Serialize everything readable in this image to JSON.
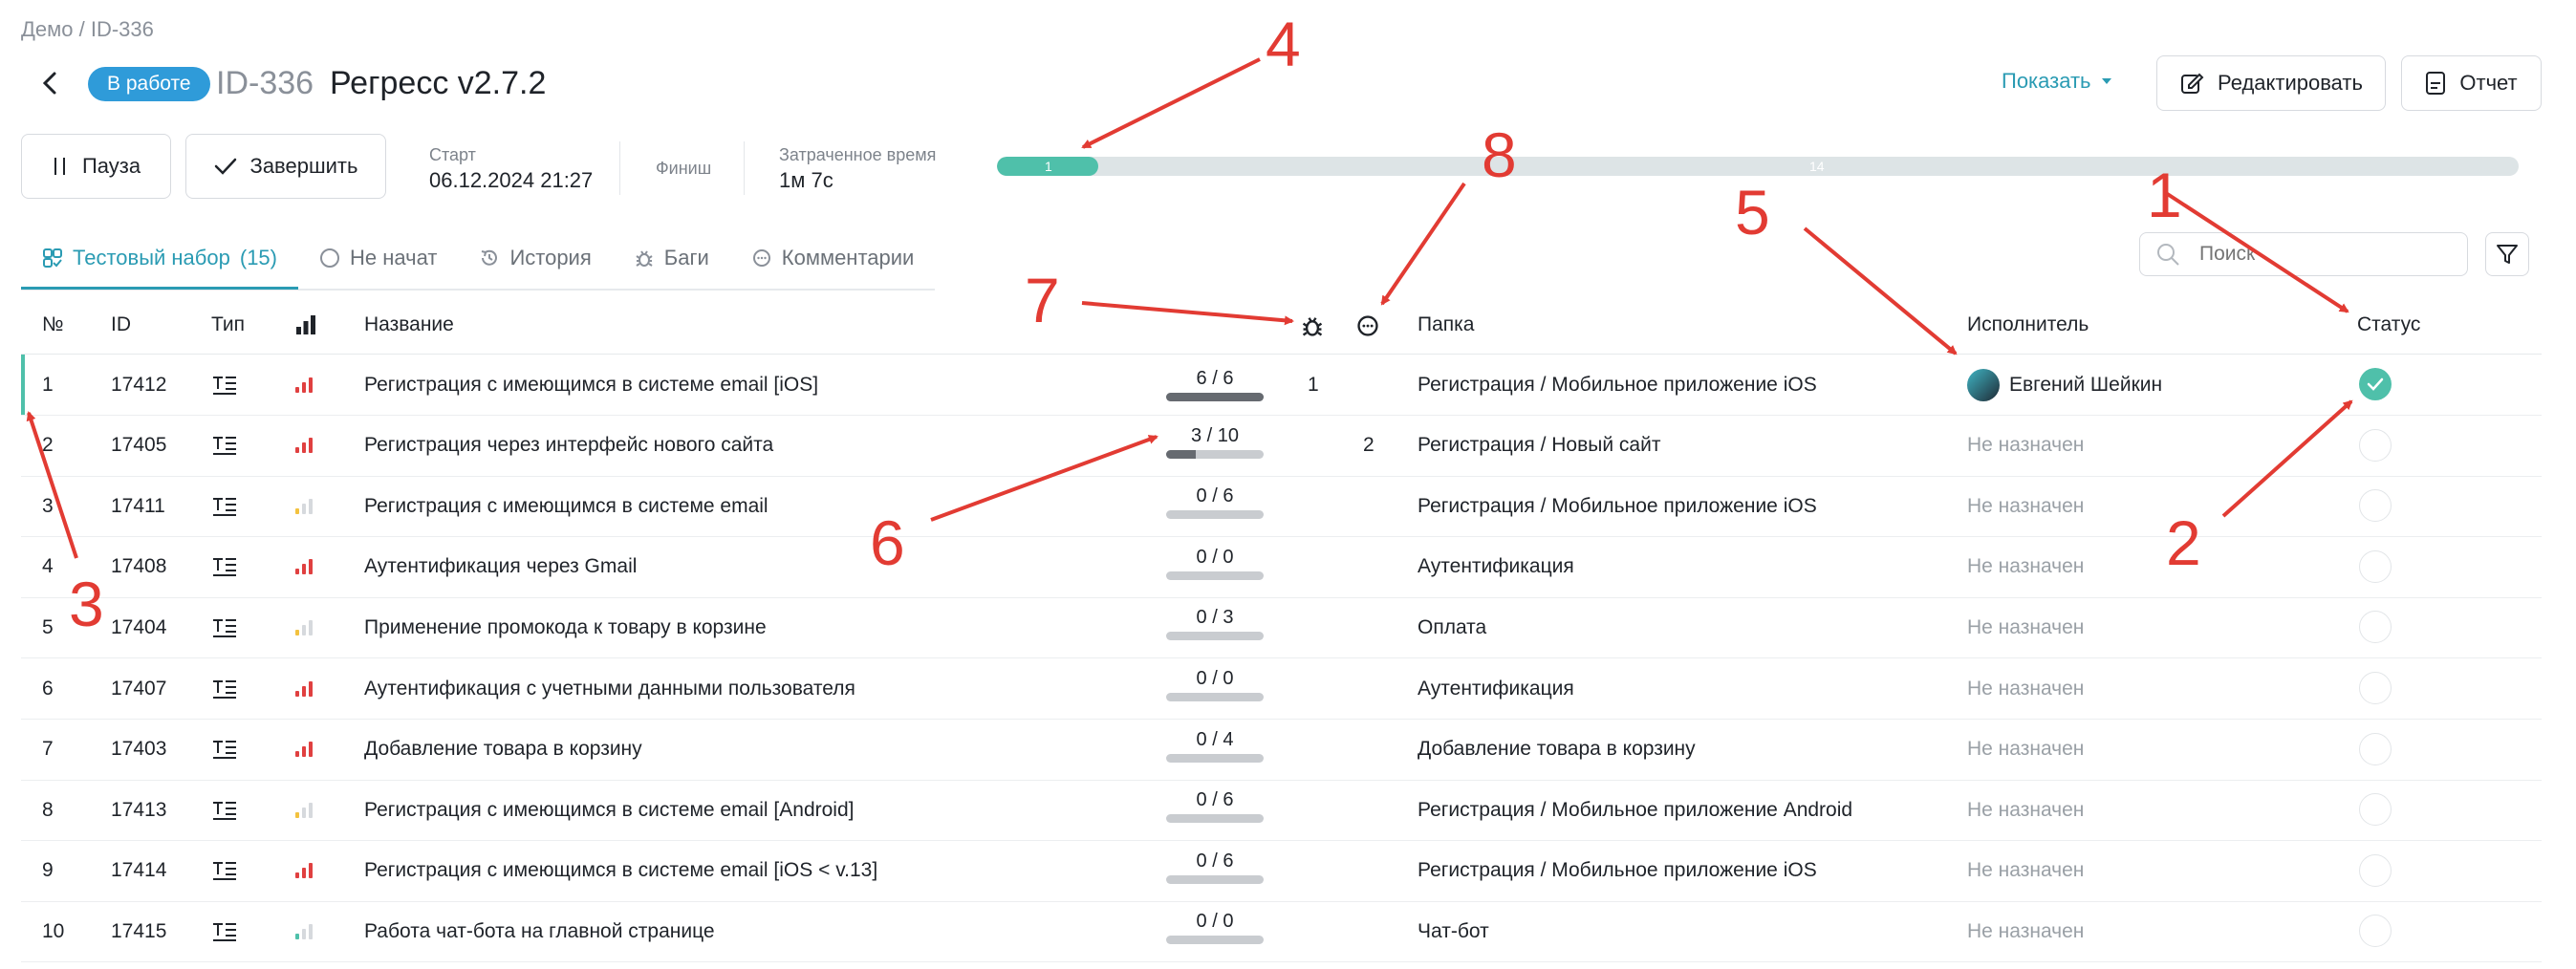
{
  "breadcrumb": "Демо / ID-336",
  "run": {
    "status": "В работе",
    "id": "ID-336",
    "name": "Регресс v2.7.2"
  },
  "toolbar": {
    "show_label": "Показать",
    "edit_label": "Редактировать",
    "report_label": "Отчет",
    "pause_label": "Пауза",
    "finish_label": "Завершить"
  },
  "meta": {
    "start_label": "Старт",
    "start_value": "06.12.2024 21:27",
    "finish_label": "Финиш",
    "spent_label": "Затраченное время",
    "spent_value": "1м 7с"
  },
  "progress": {
    "done": 1,
    "total": 15,
    "done_label": "1",
    "total_label": "14"
  },
  "tabs": [
    {
      "label": "Тестовый набор",
      "count": "(15)",
      "icon": "test-suite-icon"
    },
    {
      "label": "Не начат",
      "icon": "circle-icon"
    },
    {
      "label": "История",
      "icon": "history-icon"
    },
    {
      "label": "Баги",
      "icon": "bug-icon"
    },
    {
      "label": "Комментарии",
      "icon": "comment-icon"
    }
  ],
  "search": {
    "placeholder": "Поиск"
  },
  "table": {
    "headers": {
      "num": "№",
      "id": "ID",
      "type": "Тип",
      "name": "Название",
      "folder": "Папка",
      "assignee": "Исполнитель",
      "status": "Статус"
    },
    "rows": [
      {
        "num": "1",
        "id": "17412",
        "priority": "high",
        "name": "Регистрация с имеющимся в системе email [iOS]",
        "steps": "6 / 6",
        "steps_done": 6,
        "steps_total": 6,
        "bugs": "1",
        "comments": "",
        "folder": "Регистрация / Мобильное приложение iOS",
        "assignee": "Евгений Шейкин",
        "assigned": true,
        "status": "passed"
      },
      {
        "num": "2",
        "id": "17405",
        "priority": "high",
        "name": "Регистрация через интерфейс нового сайта",
        "steps": "3 / 10",
        "steps_done": 3,
        "steps_total": 10,
        "bugs": "",
        "comments": "2",
        "folder": "Регистрация / Новый сайт",
        "assignee": "Не назначен",
        "assigned": false,
        "status": "none"
      },
      {
        "num": "3",
        "id": "17411",
        "priority": "medium",
        "name": "Регистрация с имеющимся в системе email",
        "steps": "0 / 6",
        "steps_done": 0,
        "steps_total": 6,
        "bugs": "",
        "comments": "",
        "folder": "Регистрация / Мобильное приложение iOS",
        "assignee": "Не назначен",
        "assigned": false,
        "status": "none"
      },
      {
        "num": "4",
        "id": "17408",
        "priority": "high",
        "name": "Аутентификация через Gmail",
        "steps": "0 / 0",
        "steps_done": 0,
        "steps_total": 0,
        "bugs": "",
        "comments": "",
        "folder": "Аутентификация",
        "assignee": "Не назначен",
        "assigned": false,
        "status": "none"
      },
      {
        "num": "5",
        "id": "17404",
        "priority": "medium",
        "name": "Применение промокода к товару в корзине",
        "steps": "0 / 3",
        "steps_done": 0,
        "steps_total": 3,
        "bugs": "",
        "comments": "",
        "folder": "Оплата",
        "assignee": "Не назначен",
        "assigned": false,
        "status": "none"
      },
      {
        "num": "6",
        "id": "17407",
        "priority": "high",
        "name": "Аутентификация с учетными данными пользователя",
        "steps": "0 / 0",
        "steps_done": 0,
        "steps_total": 0,
        "bugs": "",
        "comments": "",
        "folder": "Аутентификация",
        "assignee": "Не назначен",
        "assigned": false,
        "status": "none"
      },
      {
        "num": "7",
        "id": "17403",
        "priority": "high",
        "name": "Добавление товара в корзину",
        "steps": "0 / 4",
        "steps_done": 0,
        "steps_total": 4,
        "bugs": "",
        "comments": "",
        "folder": "Добавление товара в корзину",
        "assignee": "Не назначен",
        "assigned": false,
        "status": "none"
      },
      {
        "num": "8",
        "id": "17413",
        "priority": "medium",
        "name": "Регистрация с имеющимся в системе email [Android]",
        "steps": "0 / 6",
        "steps_done": 0,
        "steps_total": 6,
        "bugs": "",
        "comments": "",
        "folder": "Регистрация / Мобильное приложение Android",
        "assignee": "Не назначен",
        "assigned": false,
        "status": "none"
      },
      {
        "num": "9",
        "id": "17414",
        "priority": "high",
        "name": "Регистрация с имеющимся в системе email [iOS < v.13]",
        "steps": "0 / 6",
        "steps_done": 0,
        "steps_total": 6,
        "bugs": "",
        "comments": "",
        "folder": "Регистрация / Мобильное приложение iOS",
        "assignee": "Не назначен",
        "assigned": false,
        "status": "none"
      },
      {
        "num": "10",
        "id": "17415",
        "priority": "low",
        "name": "Работа чат-бота на главной странице",
        "steps": "0 / 0",
        "steps_done": 0,
        "steps_total": 0,
        "bugs": "",
        "comments": "",
        "folder": "Чат-бот",
        "assignee": "Не назначен",
        "assigned": false,
        "status": "none"
      }
    ]
  },
  "annotations": [
    "1",
    "2",
    "3",
    "4",
    "5",
    "6",
    "7",
    "8"
  ],
  "colors": {
    "accent": "#2a9bb3",
    "success": "#4fc0aa",
    "badge": "#2f9bd9",
    "annotation": "#e23b33",
    "priority_high": "#e04040",
    "priority_medium": "#f3c23f",
    "priority_low": "#4fc0aa"
  }
}
